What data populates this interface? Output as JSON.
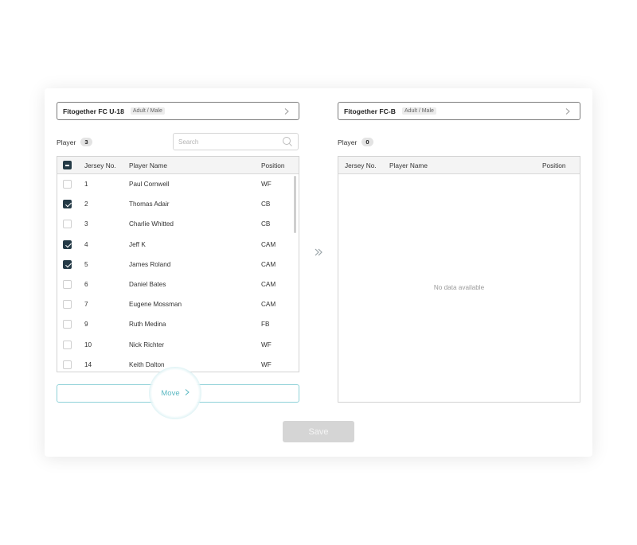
{
  "left_panel": {
    "team": {
      "name": "Fitogether FC U-18",
      "tag": "Adult / Male"
    },
    "player_label": "Player",
    "player_count": "3",
    "search": {
      "placeholder": "Search"
    },
    "columns": {
      "jersey": "Jersey No.",
      "name": "Player Name",
      "position": "Position"
    },
    "header_checkbox_state": "indeterminate",
    "rows": [
      {
        "jersey": "1",
        "name": "Paul Cornwell",
        "position": "WF",
        "checked": false
      },
      {
        "jersey": "2",
        "name": "Thomas Adair",
        "position": "CB",
        "checked": true
      },
      {
        "jersey": "3",
        "name": "Charlie Whitted",
        "position": "CB",
        "checked": false
      },
      {
        "jersey": "4",
        "name": "Jeff K",
        "position": "CAM",
        "checked": true
      },
      {
        "jersey": "5",
        "name": "James Roland",
        "position": "CAM",
        "checked": true
      },
      {
        "jersey": "6",
        "name": "Daniel Bates",
        "position": "CAM",
        "checked": false
      },
      {
        "jersey": "7",
        "name": "Eugene Mossman",
        "position": "CAM",
        "checked": false
      },
      {
        "jersey": "9",
        "name": "Ruth Medina",
        "position": "FB",
        "checked": false
      },
      {
        "jersey": "10",
        "name": "Nick Richter",
        "position": "WF",
        "checked": false
      },
      {
        "jersey": "14",
        "name": "Keith Dalton",
        "position": "WF",
        "checked": false
      }
    ],
    "move_button": {
      "label": "Move"
    }
  },
  "right_panel": {
    "team": {
      "name": "Fitogether FC-B",
      "tag": "Adult / Male"
    },
    "player_label": "Player",
    "player_count": "0",
    "columns": {
      "jersey": "Jersey No.",
      "name": "Player Name",
      "position": "Position"
    },
    "empty_text": "No data available"
  },
  "save_button": {
    "label": "Save"
  },
  "icons": {
    "chevron": "chevron-right-icon",
    "search": "search-icon",
    "transfer": "double-chevron-right-icon"
  },
  "colors": {
    "checkbox_checked": "#243a46",
    "move_accent": "#5bb8c2",
    "save_disabled": "#d5d5d5"
  }
}
